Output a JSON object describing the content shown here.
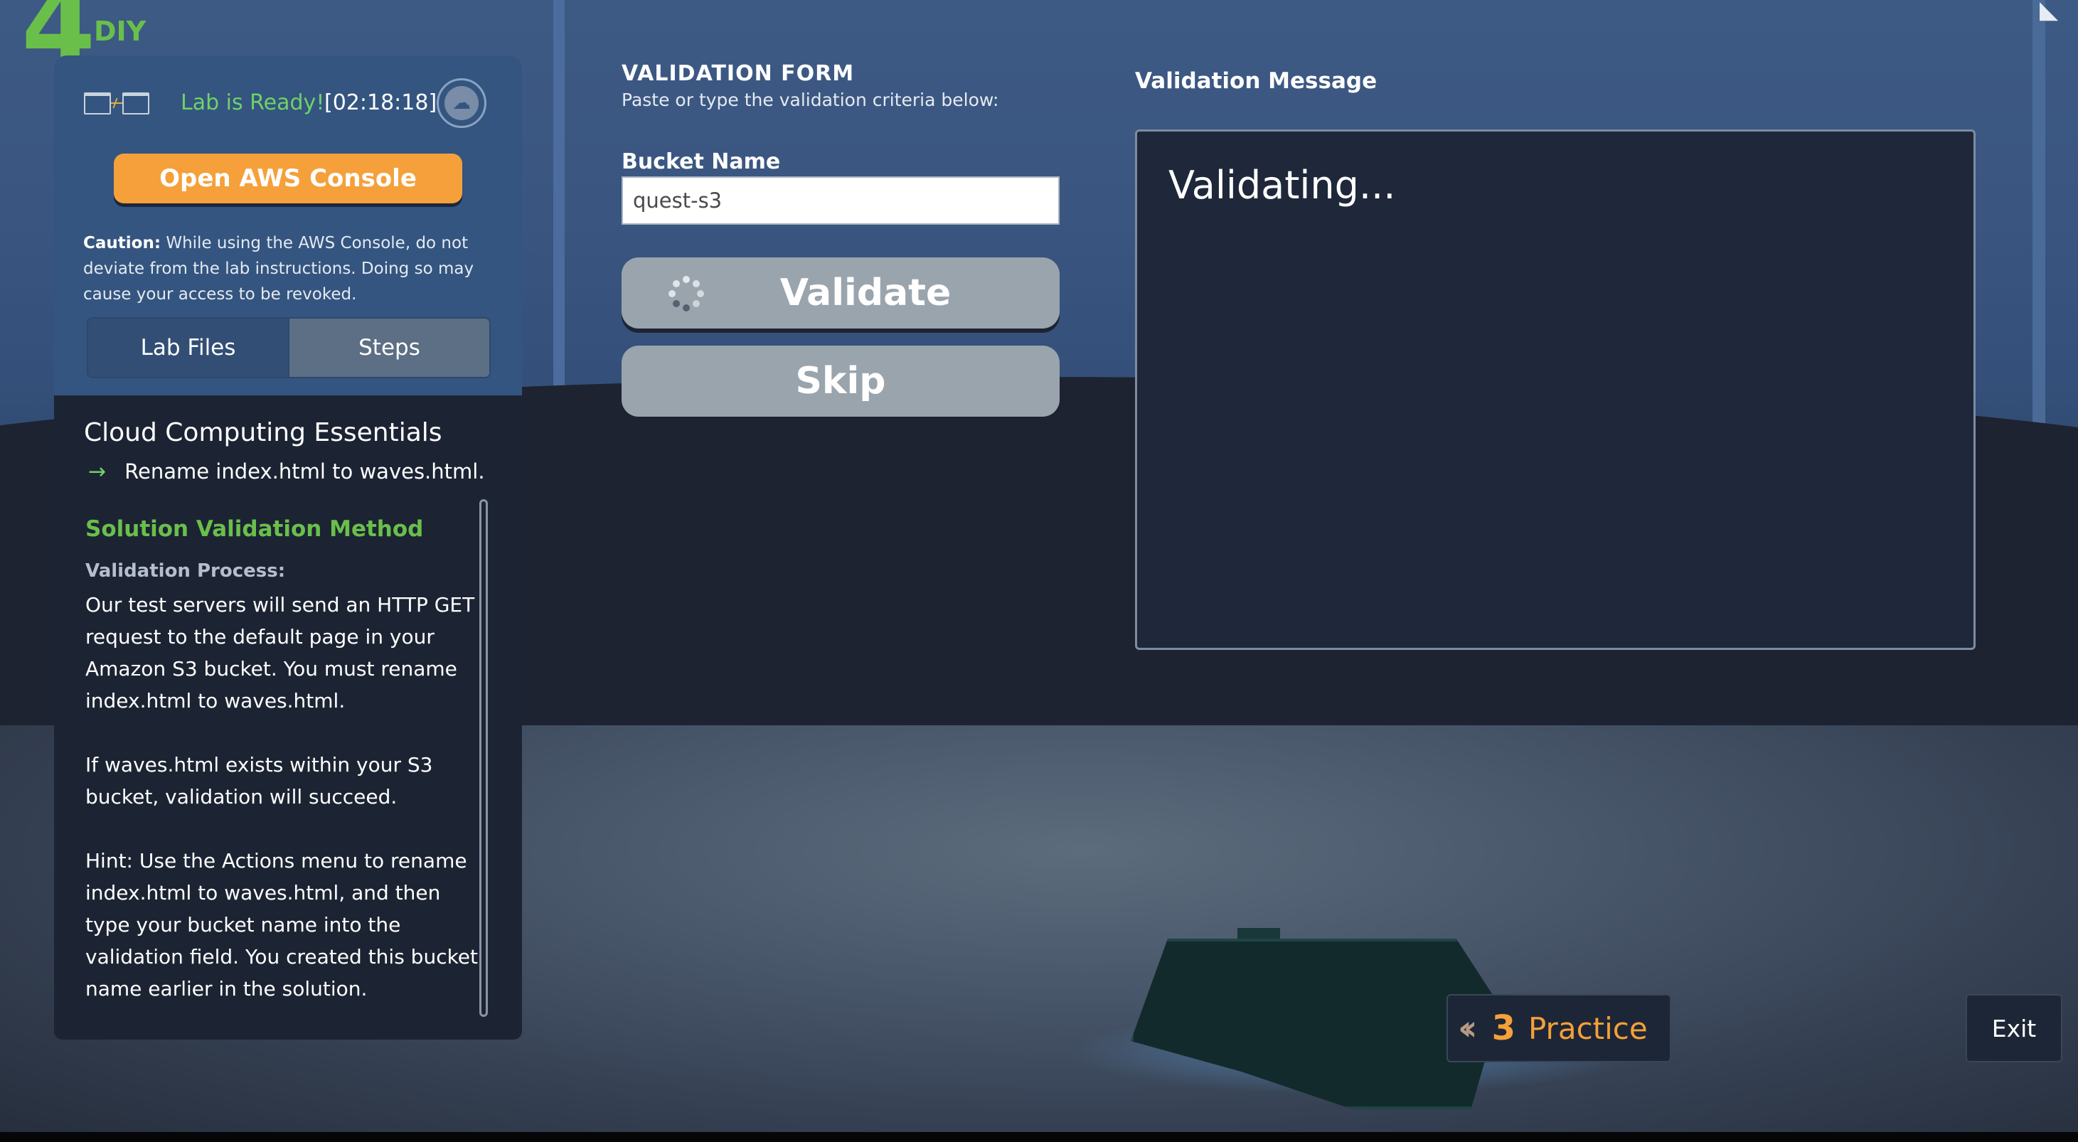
{
  "logo": {
    "number": "4",
    "text": "DIY"
  },
  "lab": {
    "status": "Lab is Ready!",
    "timer": "[02:18:18]",
    "console_button": "Open AWS Console",
    "caution_label": "Caution:",
    "caution_text": " While using the AWS Console, do not deviate from the lab instructions. Doing so may cause your access to be revoked."
  },
  "tabs": [
    {
      "label": "Lab Files",
      "active": false
    },
    {
      "label": "Steps",
      "active": true
    }
  ],
  "steps": {
    "course_title": "Cloud Computing Essentials",
    "current_step": "Rename index.html to waves.html.",
    "solution_heading": "Solution Validation Method",
    "process_label": "Validation Process:",
    "paragraphs": [
      "Our test servers will send an HTTP GET request to the default page in your Amazon S3 bucket. You must rename index.html to waves.html.",
      "If waves.html exists within your S3 bucket, validation will succeed.",
      "Hint: Use the Actions menu to rename index.html to waves.html, and then type your bucket name into the validation field. You created this bucket name earlier in the solution."
    ]
  },
  "form": {
    "title": "VALIDATION FORM",
    "subtitle": "Paste or type the validation criteria below:",
    "bucket_label": "Bucket Name",
    "bucket_value": "quest-s3",
    "validate_label": "Validate",
    "skip_label": "Skip"
  },
  "message": {
    "title": "Validation Message",
    "text": "Validating..."
  },
  "nav": {
    "practice_number": "3",
    "practice_label": "Practice",
    "exit_label": "Exit"
  },
  "icons": {
    "lab_window": "window-pulse-icon",
    "cloud": "cloud-upload-icon",
    "step_arrow": "arrow-right-icon",
    "spinner": "loading-spinner-icon",
    "back": "double-chevron-left-icon"
  },
  "colors": {
    "accent_orange": "#f5a03a",
    "ready_green": "#6fd16a",
    "heading_green": "#6abf4b",
    "panel_blue": "#34557f",
    "panel_dark": "#1c2433"
  }
}
